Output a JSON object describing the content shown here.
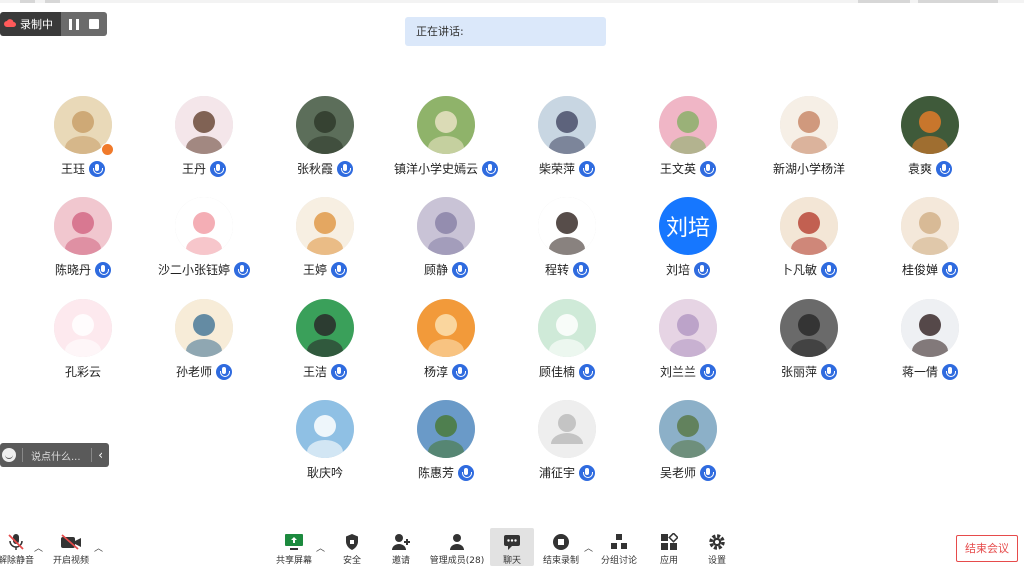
{
  "recording": {
    "label": "录制中"
  },
  "speaking": {
    "label": "正在讲话:"
  },
  "participants": [
    {
      "name": "王珏",
      "mic": true
    },
    {
      "name": "王丹",
      "mic": true
    },
    {
      "name": "张秋霞",
      "mic": true
    },
    {
      "name": "镇洋小学史嫣云",
      "mic": true
    },
    {
      "name": "柴荣萍",
      "mic": true
    },
    {
      "name": "王文英",
      "mic": true
    },
    {
      "name": "新湖小学杨洋",
      "mic": false
    },
    {
      "name": "袁爽",
      "mic": true
    },
    {
      "name": "陈晓丹",
      "mic": true
    },
    {
      "name": "沙二小张钰婷",
      "mic": true
    },
    {
      "name": "王婷",
      "mic": true
    },
    {
      "name": "顾静",
      "mic": true
    },
    {
      "name": "程转",
      "mic": true
    },
    {
      "name": "刘培",
      "mic": true,
      "avatar_text": "刘培"
    },
    {
      "name": "卜凡敏",
      "mic": true
    },
    {
      "name": "桂俊婵",
      "mic": true
    },
    {
      "name": "孔彩云",
      "mic": false
    },
    {
      "name": "孙老师",
      "mic": true
    },
    {
      "name": "王洁",
      "mic": true
    },
    {
      "name": "杨淳",
      "mic": true
    },
    {
      "name": "顾佳楠",
      "mic": true
    },
    {
      "name": "刘兰兰",
      "mic": true
    },
    {
      "name": "张丽萍",
      "mic": true
    },
    {
      "name": "蒋一倩",
      "mic": true
    },
    {
      "name": "耿庆吟",
      "mic": false
    },
    {
      "name": "陈惠芳",
      "mic": true
    },
    {
      "name": "浦征宇",
      "mic": true
    },
    {
      "name": "吴老师",
      "mic": true
    }
  ],
  "chat": {
    "placeholder": "说点什么..."
  },
  "toolbar": {
    "unmute": "解除静音",
    "video": "开启视频",
    "share": "共享屏幕",
    "security": "安全",
    "invite": "邀请",
    "members": "管理成员(28)",
    "chat": "聊天",
    "end_record": "结束录制",
    "breakout": "分组讨论",
    "apps": "应用",
    "settings": "设置",
    "end_meeting": "结束会议"
  },
  "colors": {
    "accent": "#2f6bdf",
    "danger": "#e64b4b",
    "speaking_bg": "#dbe8fa"
  }
}
